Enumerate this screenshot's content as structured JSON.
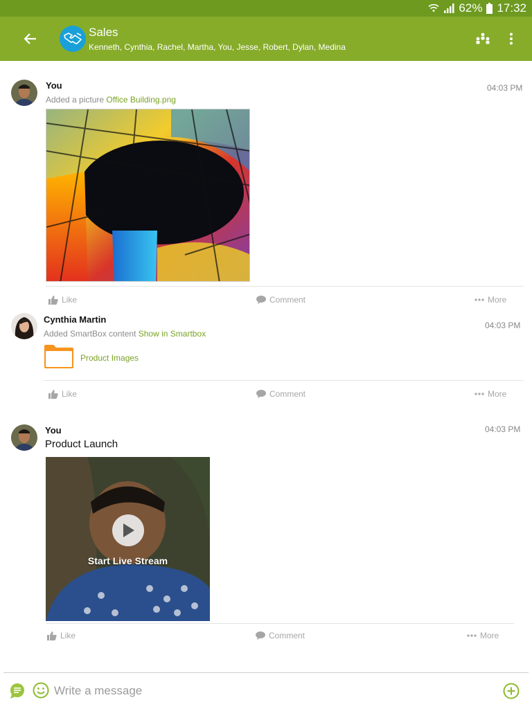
{
  "status_bar": {
    "battery": "62%",
    "time": "17:32"
  },
  "header": {
    "title": "Sales",
    "members": "Kenneth, Cynthia, Rachel, Martha, You, Jesse, Robert, Dylan, Medina",
    "icons": [
      "back-arrow-icon",
      "handshake-icon",
      "group-members-icon",
      "more-vertical-icon"
    ]
  },
  "posts": [
    {
      "author": "You",
      "time": "04:03 PM",
      "action_text": "Added a picture ",
      "link_text": "Office Building.png"
    },
    {
      "author": "Cynthia Martin",
      "time": "04:03 PM",
      "action_text": "Added SmartBox content ",
      "link_text": "Show in Smartbox",
      "folder_name": "Product Images"
    },
    {
      "author": "You",
      "time": "04:03 PM",
      "title": "Product Launch",
      "video_label": "Start Live Stream"
    }
  ],
  "post_actions": {
    "like": "Like",
    "comment": "Comment",
    "more": "More"
  },
  "composer": {
    "placeholder": "Write a message"
  },
  "colors": {
    "status_bar": "#6d9a1f",
    "app_bar": "#86ac2a",
    "accent_link": "#7aa322",
    "group_avatar": "#1aa0d8",
    "folder": "#f7941d"
  }
}
